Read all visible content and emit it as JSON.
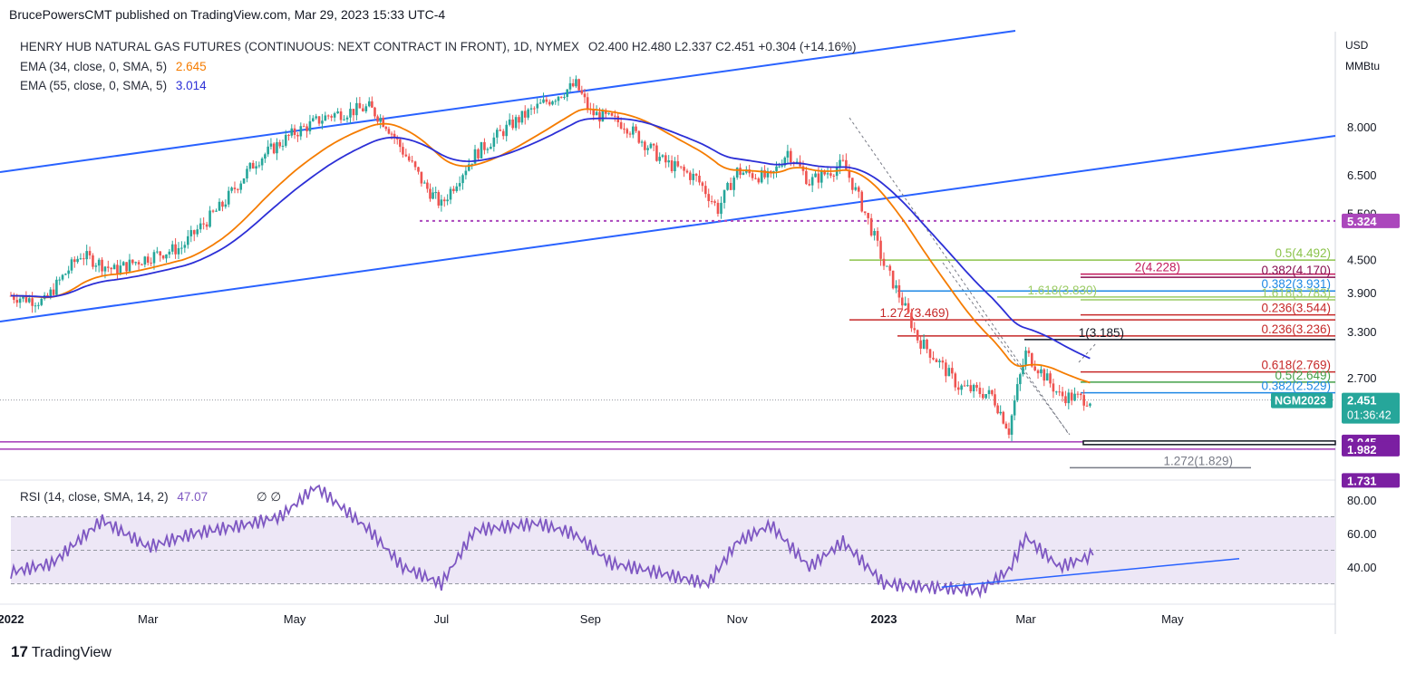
{
  "header": {
    "publisher": "BrucePowersCMT published on TradingView.com, Mar 29, 2023 15:33 UTC-4"
  },
  "legend": {
    "main": "HENRY HUB NATURAL GAS FUTURES (CONTINUOUS: NEXT CONTRACT IN FRONT), 1D, NYMEX",
    "ohlc": "O2.400  H2.480  L2.337  C2.451  +0.304 (+14.16%)",
    "ema34_label": "EMA (34, close, 0, SMA, 5)",
    "ema34_value": "2.645",
    "ema55_label": "EMA (55, close, 0, SMA, 5)",
    "ema55_value": "3.014",
    "rsi_label": "RSI (14, close, SMA, 14, 2)",
    "rsi_value": "47.07",
    "rsi_extra": "∅  ∅"
  },
  "footer": {
    "logo_mark": "17",
    "logo_text": "TradingView"
  },
  "colors": {
    "up": "#26a69a",
    "down": "#ef5350",
    "ema34": "#f57c00",
    "ema55": "#2c2fd6",
    "channel": "#2962ff",
    "rsi": "#7e57c2",
    "rsi_band": "#ede7f6"
  },
  "chart_data": {
    "type": "candlestick",
    "symbol": "NGM2023",
    "price_unit": "USD MMBtu",
    "price_axis_ticks": [
      8.0,
      6.5,
      5.5,
      4.5,
      3.9,
      3.3,
      2.7
    ],
    "time_axis_labels": [
      "2022",
      "Mar",
      "May",
      "Jul",
      "Sep",
      "Nov",
      "2023",
      "Mar",
      "May"
    ],
    "price_series": {
      "dates": [
        "2022-01-03",
        "2022-01-17",
        "2022-02-01",
        "2022-02-15",
        "2022-03-01",
        "2022-03-15",
        "2022-04-01",
        "2022-04-15",
        "2022-05-01",
        "2022-05-15",
        "2022-06-01",
        "2022-06-08",
        "2022-06-15",
        "2022-06-24",
        "2022-07-01",
        "2022-07-15",
        "2022-08-01",
        "2022-08-15",
        "2022-08-26",
        "2022-09-01",
        "2022-09-15",
        "2022-10-01",
        "2022-10-15",
        "2022-10-24",
        "2022-11-01",
        "2022-11-15",
        "2022-11-22",
        "2022-12-01",
        "2022-12-15",
        "2023-01-01",
        "2023-01-15",
        "2023-02-01",
        "2023-02-15",
        "2023-02-22",
        "2023-03-01",
        "2023-03-15",
        "2023-03-29"
      ],
      "close": [
        3.85,
        3.75,
        4.6,
        4.3,
        4.55,
        4.75,
        5.7,
        6.9,
        7.8,
        8.4,
        8.7,
        8.1,
        7.2,
        6.2,
        5.7,
        7.1,
        8.2,
        9.0,
        9.6,
        8.5,
        8.1,
        6.9,
        6.4,
        5.6,
        6.6,
        6.4,
        7.2,
        6.3,
        6.8,
        4.4,
        3.2,
        2.6,
        2.5,
        2.15,
        3.0,
        2.5,
        2.451
      ]
    },
    "ema34": {
      "label": "EMA (34, close, 0, SMA, 5)",
      "value": 2.645
    },
    "ema55": {
      "label": "EMA (55, close, 0, SMA, 5)",
      "value": 3.014
    },
    "last": {
      "open": 2.4,
      "high": 2.48,
      "low": 2.337,
      "close": 2.451,
      "change": "+0.304 (+14.16%)",
      "timer": "01:36:42"
    },
    "horizontal_levels": [
      {
        "label": "0.5(4.492)",
        "price": 4.492,
        "color": "#8bc34a"
      },
      {
        "label": "2(4.228)",
        "price": 4.228,
        "color": "#c2185b"
      },
      {
        "label": "0.382(4.170)",
        "price": 4.17,
        "color": "#880e4f"
      },
      {
        "label": "0.382(3.931)",
        "price": 3.931,
        "color": "#1e88e5"
      },
      {
        "label": "1.618(3.830)",
        "price": 3.83,
        "color": "#9ccc65"
      },
      {
        "label": "1.618(3.783)",
        "price": 3.783,
        "color": "#9ccc65"
      },
      {
        "label": "1.272(3.469)",
        "price": 3.469,
        "color": "#c62828"
      },
      {
        "label": "0.236(3.544)",
        "price": 3.544,
        "color": "#c62828"
      },
      {
        "label": "0.236(3.236)",
        "price": 3.236,
        "color": "#c62828"
      },
      {
        "label": "1(3.185)",
        "price": 3.185,
        "color": "#131722"
      },
      {
        "label": "0.618(2.769)",
        "price": 2.769,
        "color": "#c62828"
      },
      {
        "label": "0.5(2.649)",
        "price": 2.649,
        "color": "#43a047"
      },
      {
        "label": "0.382(2.529)",
        "price": 2.529,
        "color": "#1e88e5"
      },
      {
        "label": "1.272(1.829)",
        "price": 1.829,
        "color": "#787b86"
      }
    ],
    "price_tags": [
      {
        "label": "5.324",
        "price": 5.324,
        "bg": "#ab47bc"
      },
      {
        "label": "2.451",
        "price": 2.451,
        "bg": "#26a69a"
      },
      {
        "label": "2.045",
        "price": 2.045,
        "bg": "#7b1fa2"
      },
      {
        "label": "1.982",
        "price": 1.982,
        "bg": "#7b1fa2"
      },
      {
        "label": "1.731",
        "price": 1.731,
        "bg": "#7b1fa2"
      }
    ],
    "support_lines": [
      2.045,
      1.982
    ],
    "channel": {
      "lower_start": 3.4,
      "lower_end_at_Dec": 5.4,
      "upper_start": 6.6,
      "upper_end_at_Aug": 11.0
    },
    "rsi": {
      "label": "RSI (14, close, SMA, 14, 2)",
      "current": 47.07,
      "ticks": [
        80.0,
        60.0,
        40.0
      ],
      "band": [
        30,
        70
      ],
      "midline": 50,
      "dates": [
        "2022-01-03",
        "2022-01-20",
        "2022-02-10",
        "2022-03-01",
        "2022-03-20",
        "2022-04-10",
        "2022-04-25",
        "2022-05-10",
        "2022-06-01",
        "2022-06-15",
        "2022-07-01",
        "2022-07-15",
        "2022-08-10",
        "2022-08-25",
        "2022-09-10",
        "2022-09-25",
        "2022-10-20",
        "2022-11-01",
        "2022-11-15",
        "2022-12-01",
        "2022-12-15",
        "2023-01-01",
        "2023-01-20",
        "2023-02-10",
        "2023-02-22",
        "2023-03-01",
        "2023-03-15",
        "2023-03-29"
      ],
      "values": [
        37,
        42,
        68,
        52,
        60,
        65,
        70,
        88,
        62,
        40,
        30,
        62,
        66,
        60,
        42,
        38,
        30,
        55,
        65,
        40,
        55,
        30,
        28,
        26,
        38,
        58,
        40,
        47
      ]
    }
  }
}
